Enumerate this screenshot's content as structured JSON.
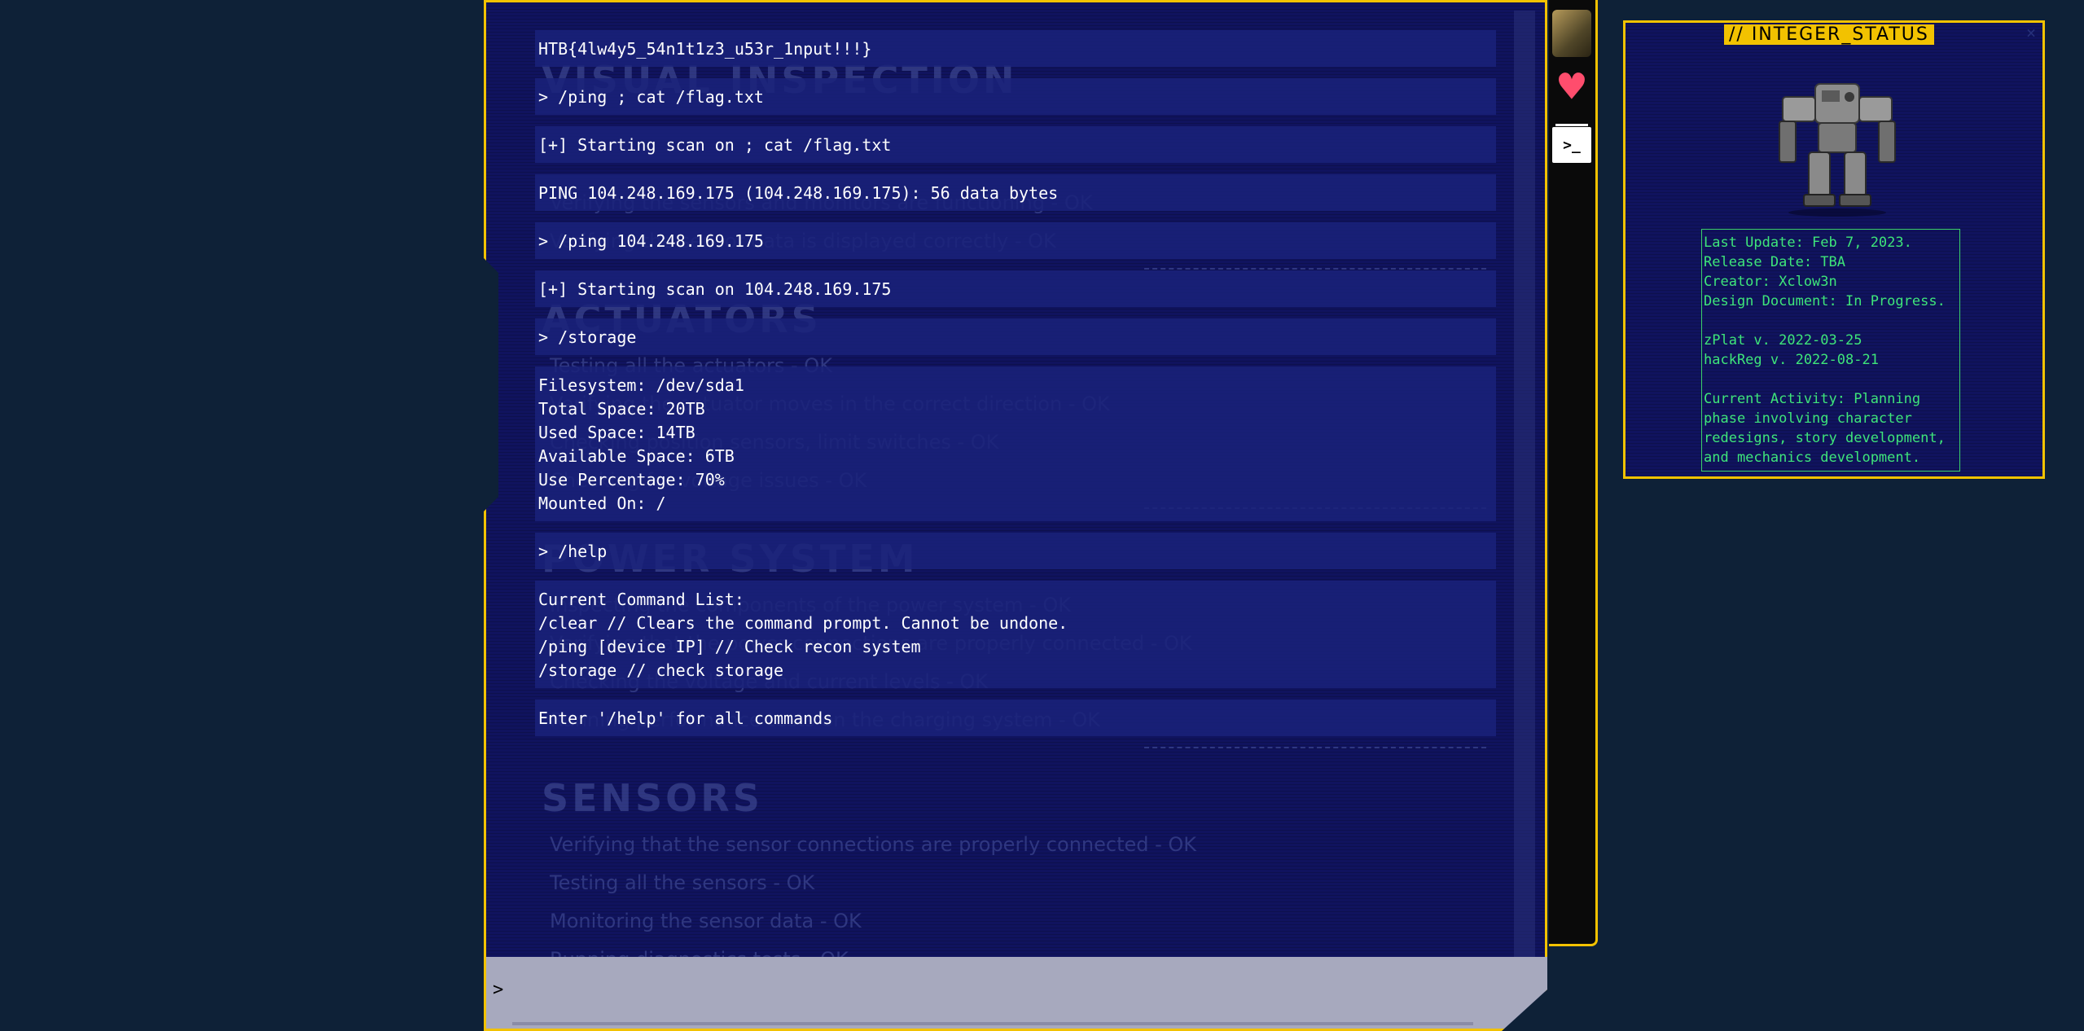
{
  "terminal": {
    "entries": [
      [
        "HTB{4lw4y5_54n1t1z3_u53r_1nput!!!}"
      ],
      [
        "> /ping ; cat /flag.txt"
      ],
      [
        "[+] Starting scan on ; cat /flag.txt"
      ],
      [
        "PING 104.248.169.175 (104.248.169.175): 56 data bytes"
      ],
      [
        "> /ping 104.248.169.175"
      ],
      [
        "[+] Starting scan on 104.248.169.175"
      ],
      [
        "> /storage"
      ],
      [
        "Filesystem: /dev/sda1",
        "Total Space: 20TB",
        "Used Space: 14TB",
        "Available Space: 6TB",
        "Use Percentage: 70%",
        "Mounted On: /"
      ],
      [
        "> /help"
      ],
      [
        "Current Command List:",
        "/clear // Clears the command prompt. Cannot be undone.",
        "/ping [device IP] // Check recon system",
        "/storage // check storage"
      ],
      [
        "Enter '/help' for all commands"
      ]
    ],
    "prompt": ">",
    "input_value": ""
  },
  "background_report": {
    "sections": [
      {
        "title": "VISUAL INSPECTION",
        "lines": [
          "",
          "",
          "Verifying the sensors and monitors are functioning - OK",
          "Verifying the sensor data is displayed correctly - OK"
        ]
      },
      {
        "title": "ACTUATORS",
        "lines": [
          "Testing all the actuators - OK",
          "Verifying the actuator moves in the correct direction - OK",
          "Checking position sensors, limit switches - OK",
          "Checking for voltage issues - OK"
        ]
      },
      {
        "title": "POWER SYSTEM",
        "lines": [
          "Inspecting the components of the power system - OK",
          "Verifying that the power connections are properly connected - OK",
          "Checking the voltage and current levels - OK",
          "Running performance tests on the charging system - OK"
        ]
      },
      {
        "title": "SENSORS",
        "lines": [
          "Verifying that the sensor connections are properly connected - OK",
          "Testing all the sensors - OK",
          "Monitoring the sensor data - OK",
          "Running diagnostics tests - OK"
        ]
      }
    ]
  },
  "sidebar": {
    "avatar": "avatar-icon",
    "heart": "heart-icon",
    "terminal": "terminal-icon",
    "terminal_glyph": ">_"
  },
  "status_panel": {
    "title": "// INTEGER_STATUS",
    "close_label": "×",
    "image": "mech-robot",
    "info_lines": [
      "Last Update: Feb 7, 2023.",
      "Release Date: TBA",
      "Creator: Xclow3n",
      "Design Document: In Progress.",
      "",
      "zPlat v. 2022-03-25",
      "hackReg v. 2022-08-21",
      "",
      "Current Activity: Planning",
      "phase involving character",
      "redesigns, story development,",
      "and mechanics development."
    ]
  },
  "colors": {
    "accent": "#f2c200",
    "terminal_bg": "#10135e",
    "status_text": "#3ee57a",
    "page_bg": "#0e2137"
  }
}
